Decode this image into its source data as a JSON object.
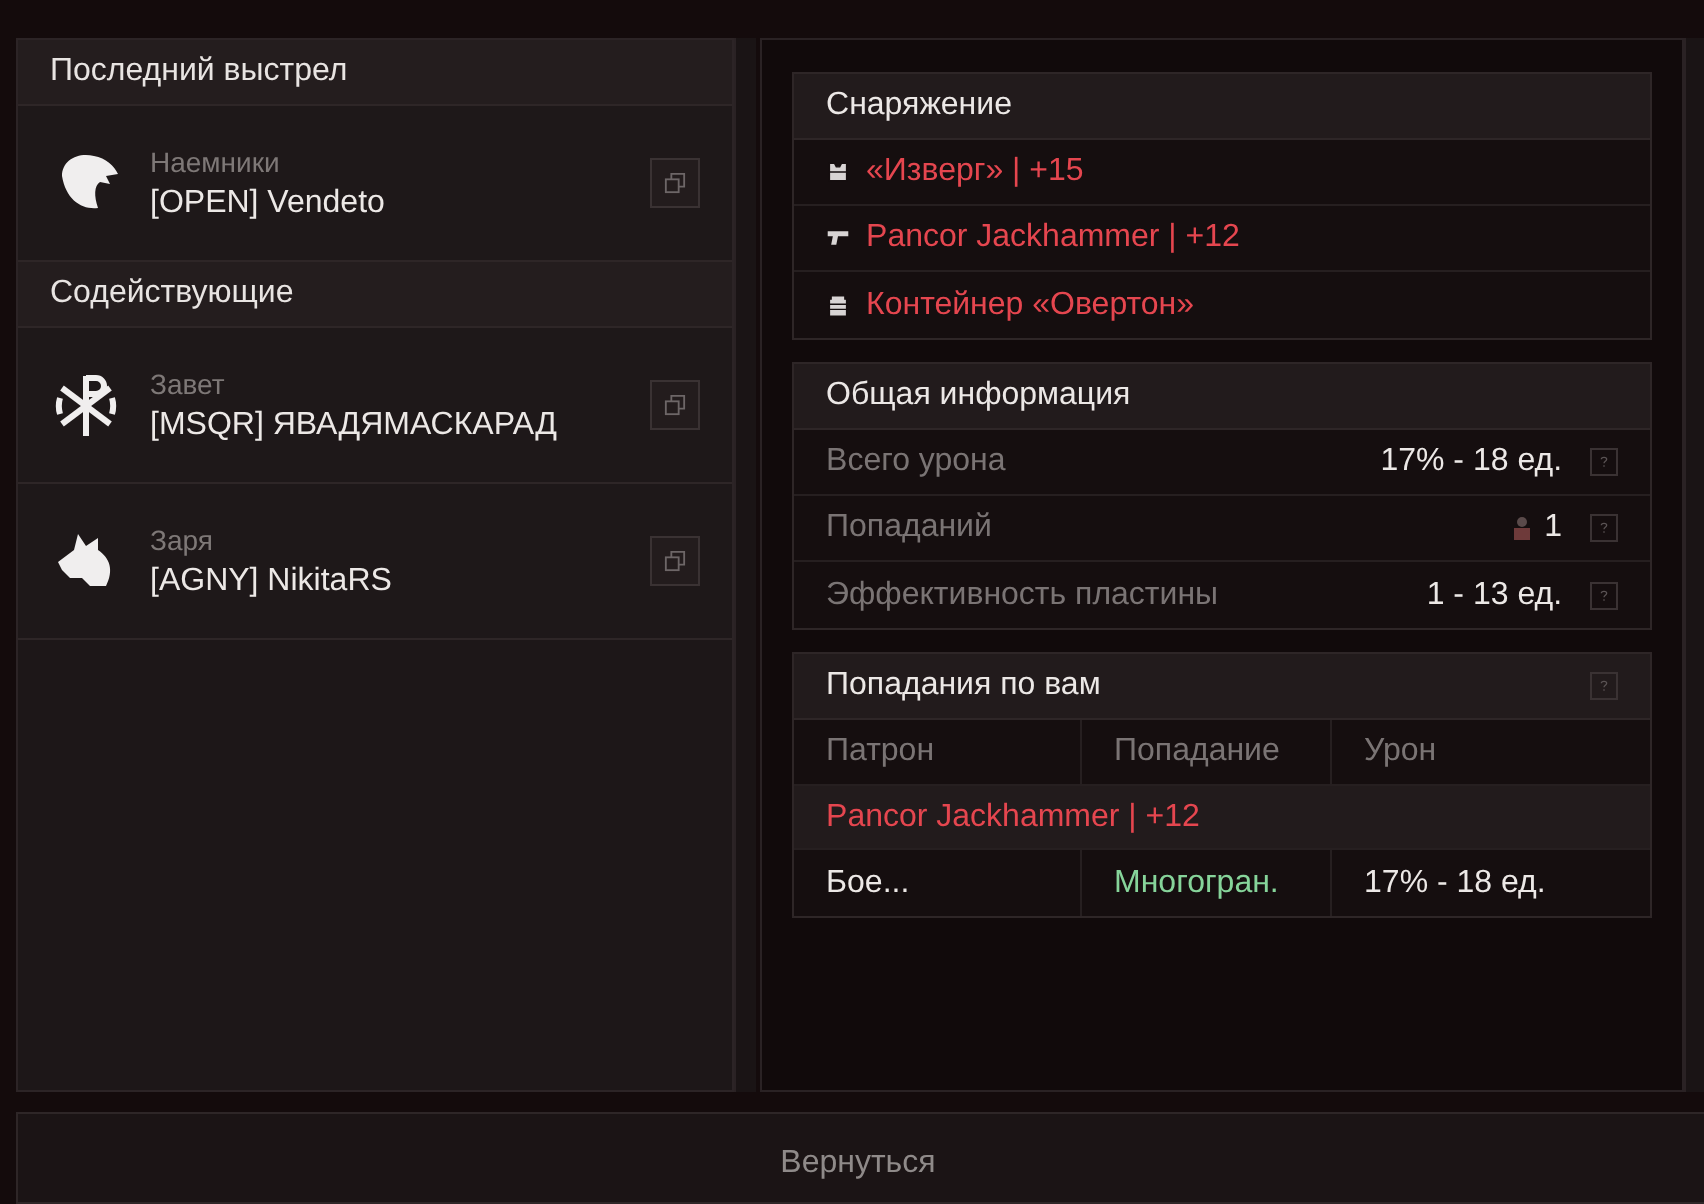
{
  "last_shot": {
    "title": "Последний выстрел",
    "players": [
      {
        "kind": "eagle",
        "faction": "Наемники",
        "name": "[OPEN] Vendeto"
      }
    ]
  },
  "assists": {
    "title": "Содействующие",
    "players": [
      {
        "kind": "cross",
        "faction": "Завет",
        "name": "[MSQR] ЯВАДЯМАСКАРАД"
      },
      {
        "kind": "wolf",
        "faction": "Заря",
        "name": "[AGNY] NikitaRS"
      }
    ]
  },
  "equipment": {
    "title": "Снаряжение",
    "items": [
      {
        "kind": "armor",
        "label": "«Изверг» | +15"
      },
      {
        "kind": "weapon",
        "label": "Pancor Jackhammer | +12"
      },
      {
        "kind": "container",
        "label": "Контейнер «Овертон»"
      }
    ]
  },
  "general": {
    "title": "Общая информация",
    "rows": [
      {
        "kind": "plain",
        "label": "Всего урона",
        "value": "17% - 18 ед."
      },
      {
        "kind": "hits",
        "label": "Попаданий",
        "value": "1"
      },
      {
        "kind": "plain",
        "label": "Эффективность пластины",
        "value": "1 - 13 ед."
      }
    ]
  },
  "hits": {
    "title": "Попадания по вам",
    "columns": [
      "Патрон",
      "Попадание",
      "Урон"
    ],
    "weapon": "Pancor Jackhammer | +12",
    "rows": [
      {
        "ammo": "Бое...",
        "hit": "Многогран.",
        "damage": "17% - 18 ед."
      }
    ]
  },
  "back_button": "Вернуться"
}
